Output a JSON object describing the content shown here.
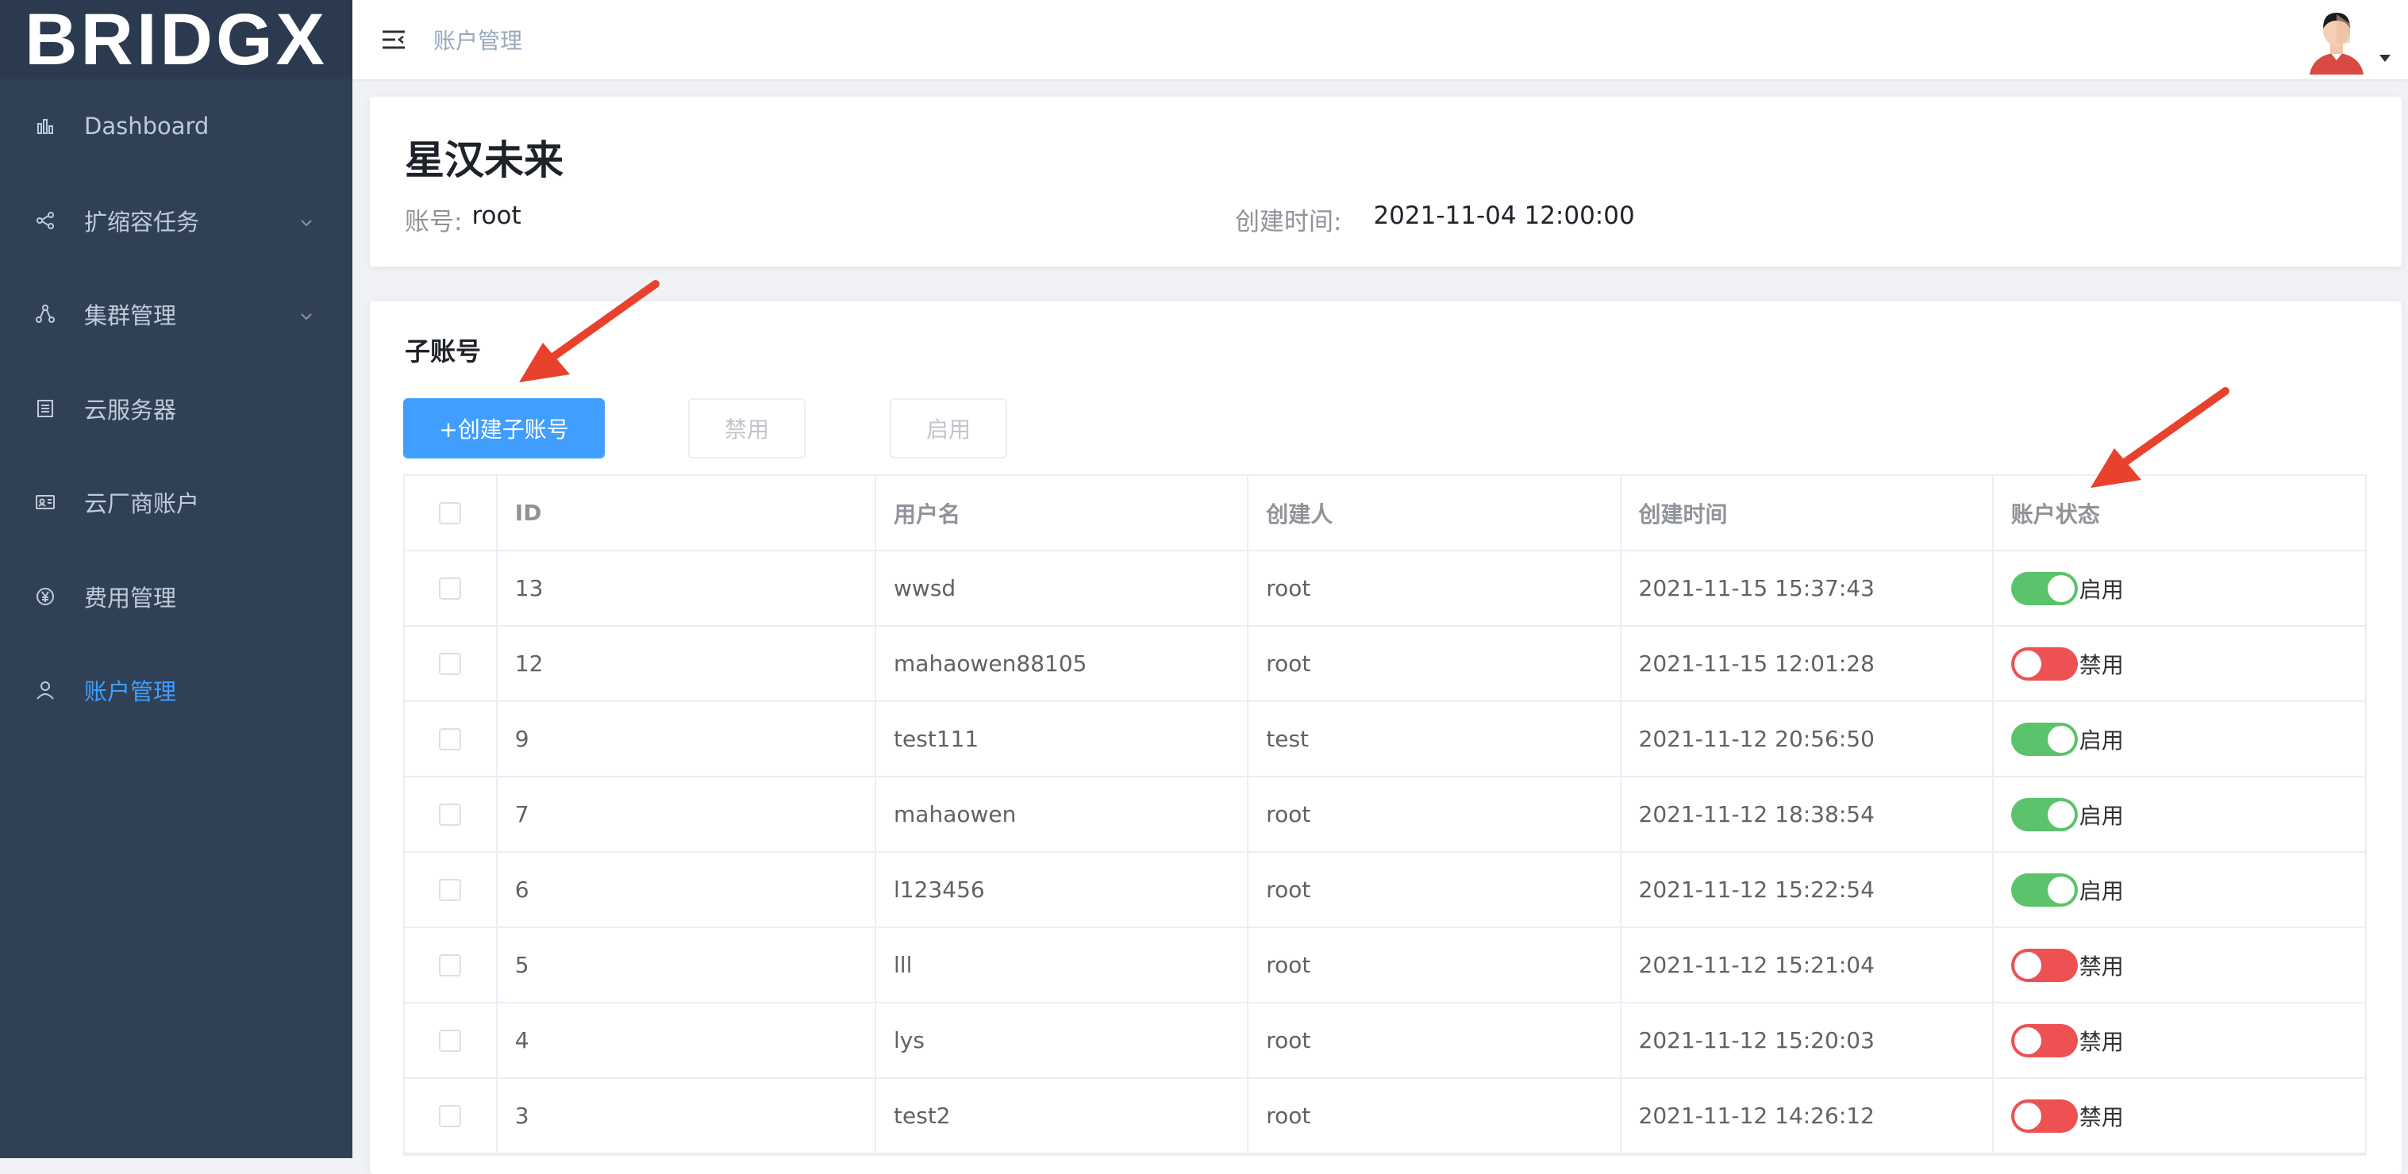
{
  "app": {
    "logo_text": "BRIDGX"
  },
  "sidebar": {
    "items": [
      {
        "label": "Dashboard",
        "icon": "bar-chart-icon",
        "expandable": false,
        "active": false
      },
      {
        "label": "扩缩容任务",
        "icon": "share-nodes-icon",
        "expandable": true,
        "active": false
      },
      {
        "label": "集群管理",
        "icon": "cluster-icon",
        "expandable": true,
        "active": false
      },
      {
        "label": "云服务器",
        "icon": "server-icon",
        "expandable": false,
        "active": false
      },
      {
        "label": "云厂商账户",
        "icon": "id-card-icon",
        "expandable": false,
        "active": false
      },
      {
        "label": "费用管理",
        "icon": "yen-circle-icon",
        "expandable": false,
        "active": false
      },
      {
        "label": "账户管理",
        "icon": "user-icon",
        "expandable": false,
        "active": true
      }
    ]
  },
  "header": {
    "breadcrumb": "账户管理"
  },
  "account": {
    "company": "星汉未来",
    "account_label": "账号:",
    "account_value": "root",
    "created_label": "创建时间:",
    "created_value": "2021-11-04 12:00:00"
  },
  "subaccounts": {
    "title": "子账号",
    "create_button": "+创建子账号",
    "disable_button": "禁用",
    "enable_button": "启用",
    "columns": [
      "ID",
      "用户名",
      "创建人",
      "创建时间",
      "账户状态"
    ],
    "rows": [
      {
        "id": "13",
        "username": "wwsd",
        "creator": "root",
        "created": "2021-11-15 15:37:43",
        "enabled": true,
        "status": "启用"
      },
      {
        "id": "12",
        "username": "mahaowen88105",
        "creator": "root",
        "created": "2021-11-15 12:01:28",
        "enabled": false,
        "status": "禁用"
      },
      {
        "id": "9",
        "username": "test111",
        "creator": "test",
        "created": "2021-11-12 20:56:50",
        "enabled": true,
        "status": "启用"
      },
      {
        "id": "7",
        "username": "mahaowen",
        "creator": "root",
        "created": "2021-11-12 18:38:54",
        "enabled": true,
        "status": "启用"
      },
      {
        "id": "6",
        "username": "l123456",
        "creator": "root",
        "created": "2021-11-12 15:22:54",
        "enabled": true,
        "status": "启用"
      },
      {
        "id": "5",
        "username": "lll",
        "creator": "root",
        "created": "2021-11-12 15:21:04",
        "enabled": false,
        "status": "禁用"
      },
      {
        "id": "4",
        "username": "lys",
        "creator": "root",
        "created": "2021-11-12 15:20:03",
        "enabled": false,
        "status": "禁用"
      },
      {
        "id": "3",
        "username": "test2",
        "creator": "root",
        "created": "2021-11-12 14:26:12",
        "enabled": false,
        "status": "禁用"
      }
    ]
  },
  "colors": {
    "sidebar_bg": "#304156",
    "primary": "#409eff",
    "switch_on": "#5ac36c",
    "switch_off": "#ed5151",
    "annotation_arrow": "#e8412c"
  }
}
